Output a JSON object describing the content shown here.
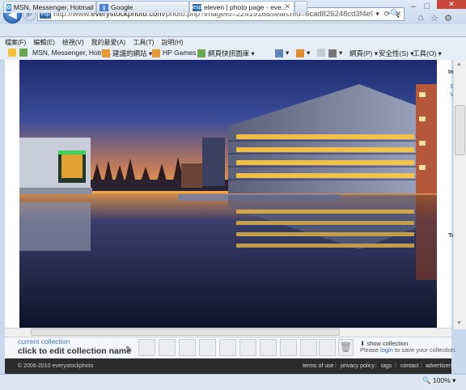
{
  "browser": {
    "url_prefix": "http://www.",
    "url_domain": "everystockphoto.com",
    "url_rest": "/photo.php?imageId=2241916&searchId=6cad826248cd3f4e93da71e7b49928e3&npos=8",
    "zoom": "100%"
  },
  "tabs": [
    {
      "label": "MSN, Messenger, Hotmail - ..."
    },
    {
      "label": "Google"
    },
    {
      "label": "eleven | photo page - eve..."
    }
  ],
  "menu": [
    "檔案(F)",
    "編輯(E)",
    "檢視(V)",
    "我的最愛(A)",
    "工具(T)",
    "說明(H)"
  ],
  "favorites": [
    {
      "label": "MSN, Messenger, Hotm..."
    },
    {
      "label": "建議的網站 ▾"
    },
    {
      "label": "HP Games ▾"
    },
    {
      "label": "網頁快訊圖庫 ▾"
    }
  ],
  "command_bar": {
    "page": "網頁(P) ▾",
    "safety": "安全性(S) ▾",
    "tools": "工具(O) ▾"
  },
  "sidebar": {
    "info_label": "Inf",
    "link_s": "S",
    "link_v": "V",
    "tag_label": "Ta"
  },
  "collection": {
    "current": "current collection",
    "edit": "click to edit collection name",
    "show": "show collection",
    "msg_before": "Please ",
    "msg_link": "login",
    "msg_after": " to save your collection."
  },
  "footer": {
    "copyright": "© 2006-2010 everystockphoto",
    "links": [
      "terms of use",
      "privacy policy",
      "tags",
      "contact",
      "advertisers"
    ]
  },
  "colors": {
    "sky_top": "#1a2a6e",
    "sky_horizon": "#f0a040",
    "water": "#101828",
    "window_light": "#ffc840"
  }
}
